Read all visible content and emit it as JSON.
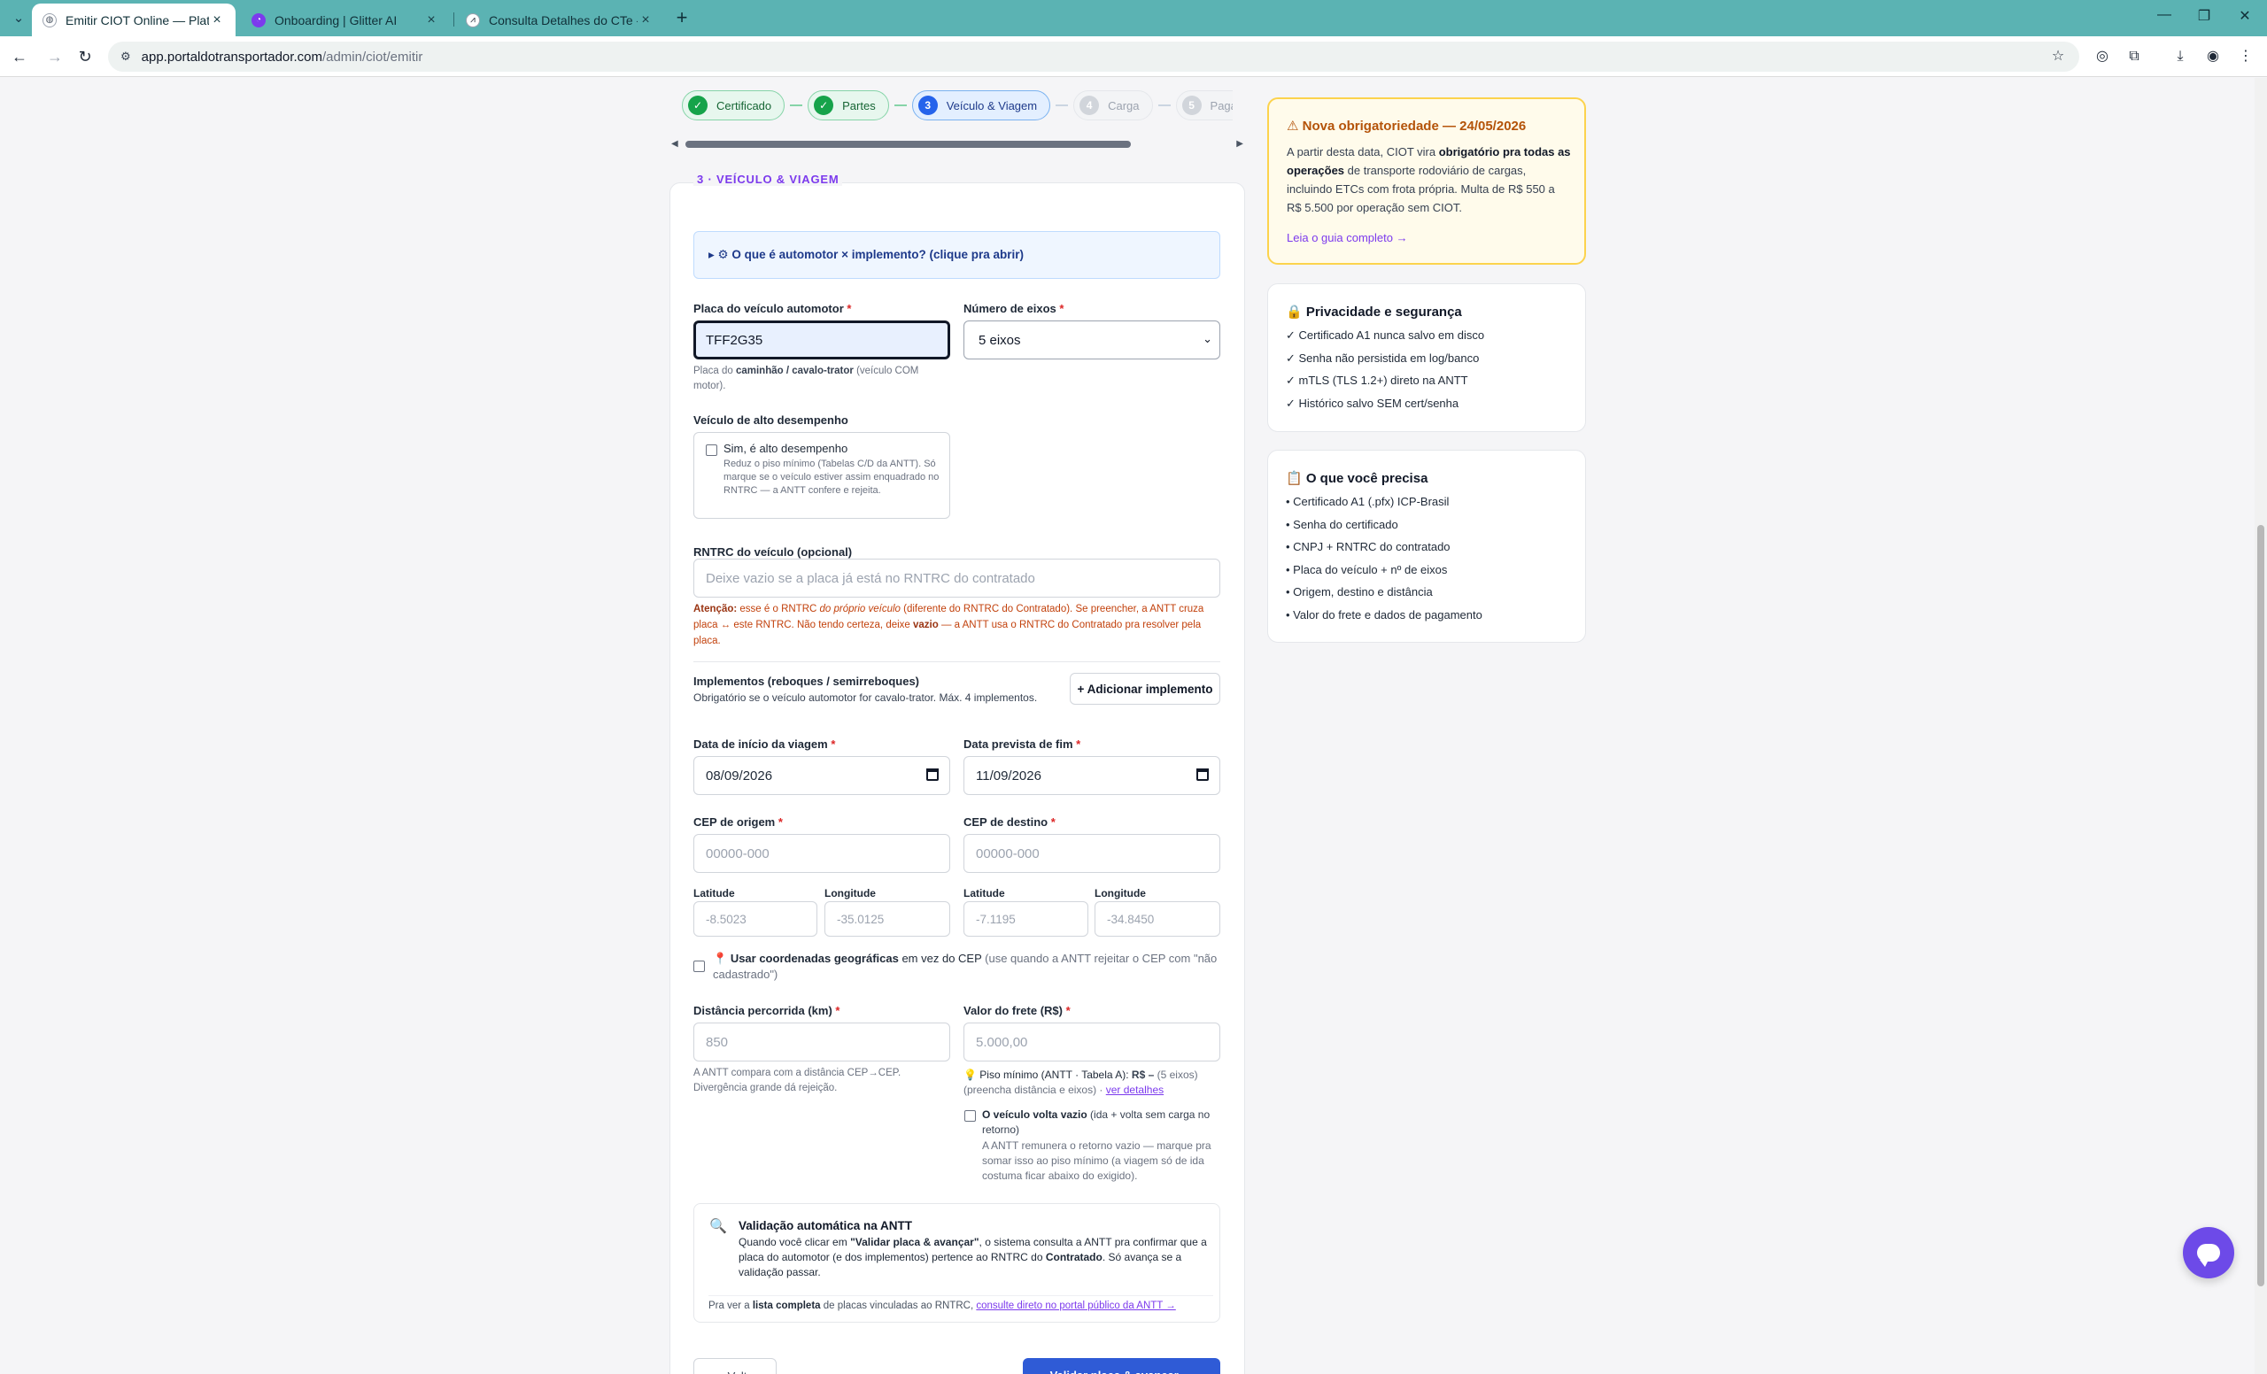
{
  "browser": {
    "tabs": [
      {
        "title": "Emitir CIOT Online — Plataform",
        "active": true
      },
      {
        "title": "Onboarding | Glitter AI",
        "active": false
      },
      {
        "title": "Consulta Detalhes do CTe - ERP",
        "active": false
      }
    ],
    "url_host": "app.portaldotransportador.com",
    "url_path": "/admin/ciot/emitir"
  },
  "stepper": {
    "steps": [
      {
        "num": "✓",
        "label": "Certificado",
        "state": "done"
      },
      {
        "num": "✓",
        "label": "Partes",
        "state": "done"
      },
      {
        "num": "3",
        "label": "Veículo & Viagem",
        "state": "current"
      },
      {
        "num": "4",
        "label": "Carga",
        "state": "todo"
      },
      {
        "num": "5",
        "label": "Pagamento",
        "state": "todo"
      }
    ]
  },
  "form": {
    "section_title": "3 · VEÍCULO & VIAGEM",
    "disclosure": "▸ ⚙ O que é automotor × implemento? (clique pra abrir)",
    "placa": {
      "label": "Placa do veículo automotor",
      "required": "*",
      "value": "TFF2G35",
      "help_pre": "Placa do ",
      "help_bold": "caminhão / cavalo-trator",
      "help_post": " (veículo COM motor)."
    },
    "eixos": {
      "label": "Número de eixos",
      "required": "*",
      "value": "5 eixos"
    },
    "alto": {
      "label": "Veículo de alto desempenho",
      "option": "Sim, é alto desempenho",
      "help": "Reduz o piso mínimo (Tabelas C/D da ANTT). Só marque se o veículo estiver assim enquadrado no RNTRC — a ANTT confere e rejeita."
    },
    "rntrc": {
      "label": "RNTRC do veículo (opcional)",
      "placeholder": "Deixe vazio se a placa já está no RNTRC do contratado",
      "warn_1": "Atenção:",
      "warn_2": " esse é o RNTRC ",
      "warn_3": "do próprio veículo",
      "warn_4": " (diferente do RNTRC do Contratado). Se preencher, a ANTT cruza placa ↔ este RNTRC. Não tendo certeza, deixe ",
      "warn_5": "vazio",
      "warn_6": " — a ANTT usa o RNTRC do Contratado pra resolver pela placa."
    },
    "implementos": {
      "title": "Implementos (reboques / semirreboques)",
      "help": "Obrigatório se o veículo automotor for cavalo-trator. Máx. 4 implementos.",
      "button": "+ Adicionar implemento"
    },
    "inicio": {
      "label": "Data de início da viagem",
      "required": "*",
      "value": "08/09/2026"
    },
    "fim": {
      "label": "Data prevista de fim",
      "required": "*",
      "value": "11/09/2026"
    },
    "cep_origem": {
      "label": "CEP de origem",
      "required": "*",
      "placeholder": "00000-000"
    },
    "cep_destino": {
      "label": "CEP de destino",
      "required": "*",
      "placeholder": "00000-000"
    },
    "coords": {
      "lat_label": "Latitude",
      "lng_label": "Longitude",
      "origem_lat": "-8.5023",
      "origem_lng": "-35.0125",
      "destino_lat": "-7.1195",
      "destino_lng": "-34.8450"
    },
    "geo": {
      "pin": "📍",
      "bold": "Usar coordenadas geográficas",
      "rest": " em vez do CEP",
      "note": " (use quando a ANTT rejeitar o CEP com \"não cadastrado\")"
    },
    "distancia": {
      "label": "Distância percorrida (km)",
      "required": "*",
      "placeholder": "850",
      "help": "A ANTT compara com a distância CEP→CEP. Divergência grande dá rejeição."
    },
    "frete": {
      "label": "Valor do frete (R$)",
      "required": "*",
      "placeholder": "5.000,00",
      "piso_icon": "💡",
      "piso_1": "Piso mínimo (ANTT · Tabela A): ",
      "piso_2": "R$  –",
      "piso_3": " (5 eixos)",
      "piso_4": "(preencha distância e eixos) · ",
      "piso_link": "ver detalhes"
    },
    "vazio": {
      "bold": "O veículo volta vazio",
      "rest": " (ida + volta sem carga no retorno)",
      "help": "A ANTT remunera o retorno vazio — marque pra somar isso ao piso mínimo (a viagem só de ida costuma ficar abaixo do exigido)."
    },
    "validacao": {
      "icon": "🔍",
      "title": "Validação automática na ANTT",
      "p1": "Quando você clicar em ",
      "p1b": "\"Validar placa & avançar\"",
      "p1c": ", o sistema consulta a ANTT pra confirmar que a placa do automotor (e dos implementos) pertence ao RNTRC do ",
      "p1d": "Contratado",
      "p1e": ". Só avança se a validação passar.",
      "p2": "Pra ver a ",
      "p2b": "lista completa",
      "p2c": " de placas vinculadas ao RNTRC, ",
      "p2link": "consulte direto no portal público da ANTT →"
    },
    "back_button": "← Voltar",
    "next_button": "Validar placa & avançar →"
  },
  "side": {
    "alert": {
      "title": "⚠ Nova obrigatoriedade — 24/05/2026",
      "p1": "A partir desta data, CIOT vira ",
      "p1b": "obrigatório pra todas as operações",
      "p1c": " de transporte rodoviário de cargas, incluindo ETCs com frota própria. Multa de R$ 550 a R$ 5.500 por operação sem CIOT.",
      "link": "Leia o guia completo →"
    },
    "privacidade": {
      "title": "🔒 Privacidade e segurança",
      "items": [
        "✓ Certificado A1 nunca salvo em disco",
        "✓ Senha não persistida em log/banco",
        "✓ mTLS (TLS 1.2+) direto na ANTT",
        "✓ Histórico salvo SEM cert/senha"
      ]
    },
    "precisa": {
      "title": "📋 O que você precisa",
      "items": [
        "• Certificado A1 (.pfx) ICP-Brasil",
        "• Senha do certificado",
        "• CNPJ + RNTRC do contratado",
        "• Placa do veículo + nº de eixos",
        "• Origem, destino e distância",
        "• Valor do frete e dados de pagamento"
      ]
    }
  },
  "colors": {
    "accent": "#7c3aed",
    "primary": "#2f5bd6",
    "success": "#16a34a",
    "warning": "#c2410c",
    "tabbar": "#5bb3b3"
  }
}
